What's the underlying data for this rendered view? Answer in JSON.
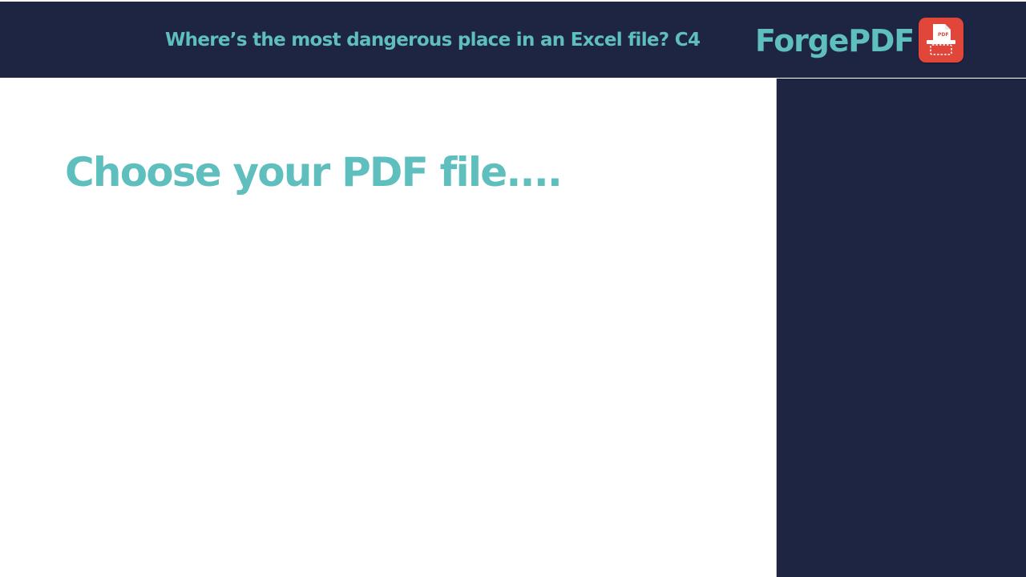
{
  "header": {
    "title": "Where’s the most dangerous place in an Excel file? C4",
    "brand": "ForgePDF",
    "logo_icon": "pdf-file-icon",
    "logo_text": "PDF"
  },
  "main": {
    "heading": "Choose your PDF file...."
  },
  "colors": {
    "navy": "#1e2542",
    "teal": "#5ebfbe",
    "logo_red": "#e0473a",
    "background": "#ffffff"
  }
}
